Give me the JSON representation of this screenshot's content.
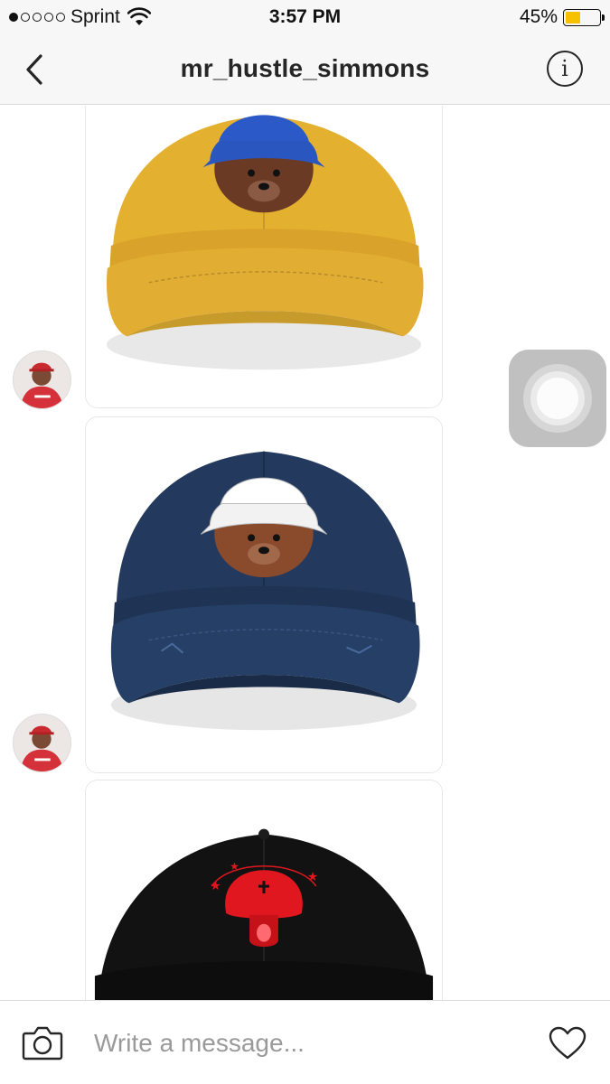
{
  "status_bar": {
    "carrier": "Sprint",
    "signal_bars_filled": 1,
    "signal_bars_total": 5,
    "time": "3:57 PM",
    "battery_percent": "45%",
    "battery_level": 0.45,
    "battery_color": "#f5c100"
  },
  "nav": {
    "back_icon": "chevron-left-icon",
    "title": "mr_hustle_simmons",
    "info_icon": "info-icon",
    "info_glyph": "i"
  },
  "messages": [
    {
      "type": "image",
      "sender": "mr_hustle_simmons",
      "content": "yellow dad hat with embroidered bear wearing blue bucket hat",
      "hat_color": "#e4b030",
      "bucket_color": "#2a56c0"
    },
    {
      "type": "image",
      "sender": "mr_hustle_simmons",
      "content": "navy dad hat with embroidered bear wearing white bucket hat",
      "hat_color": "#223a5e",
      "bucket_color": "#f2f2f2"
    },
    {
      "type": "image",
      "sender": "mr_hustle_simmons",
      "content": "black dad hat with red embroidered mushroom logo",
      "hat_color": "#121212",
      "logo_color": "#e0171f"
    }
  ],
  "composer": {
    "camera_icon": "camera-icon",
    "placeholder": "Write a message...",
    "heart_icon": "heart-icon"
  },
  "colors": {
    "accent_text": "#262626",
    "bar_background": "#f7f7f7"
  }
}
